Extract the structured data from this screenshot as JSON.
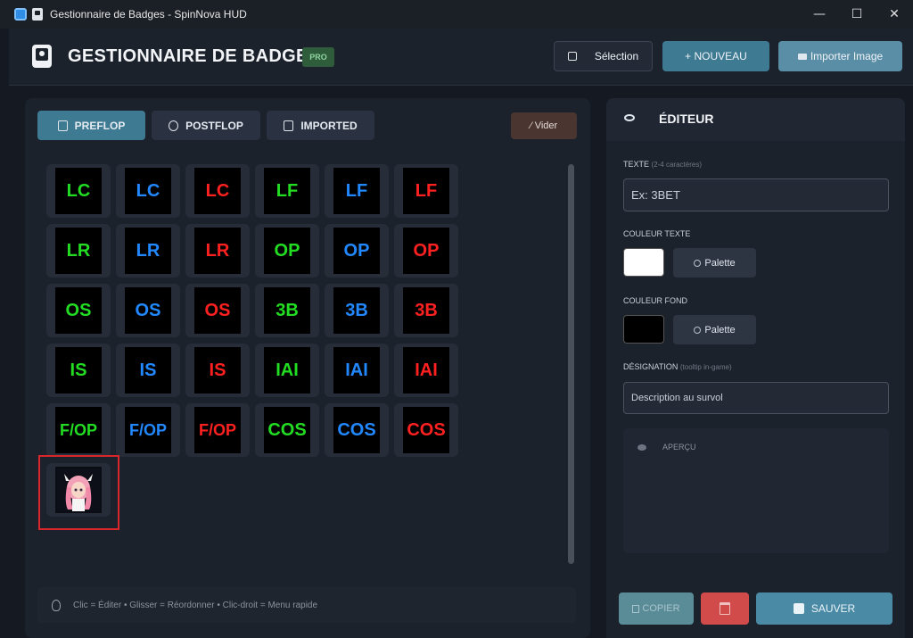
{
  "window": {
    "title": "Gestionnaire de Badges - SpinNova HUD",
    "controls": {
      "minimize": "—",
      "maximize": "☐",
      "close": "✕"
    }
  },
  "header": {
    "title": "GESTIONNAIRE DE BADGES",
    "pro_badge": "PRO",
    "selection_label": "Sélection",
    "new_label": "+ NOUVEAU",
    "import_label": "Importer Image"
  },
  "tabs": [
    {
      "label": "PREFLOP",
      "active": true
    },
    {
      "label": "POSTFLOP",
      "active": false
    },
    {
      "label": "IMPORTED",
      "active": false
    }
  ],
  "clear_label": "Vider",
  "badges": [
    {
      "text": "LC",
      "color": "green"
    },
    {
      "text": "LC",
      "color": "blue"
    },
    {
      "text": "LC",
      "color": "red"
    },
    {
      "text": "LF",
      "color": "green"
    },
    {
      "text": "LF",
      "color": "blue"
    },
    {
      "text": "LF",
      "color": "red"
    },
    {
      "text": "LR",
      "color": "green"
    },
    {
      "text": "LR",
      "color": "blue"
    },
    {
      "text": "LR",
      "color": "red"
    },
    {
      "text": "OP",
      "color": "green"
    },
    {
      "text": "OP",
      "color": "blue"
    },
    {
      "text": "OP",
      "color": "red"
    },
    {
      "text": "OS",
      "color": "green"
    },
    {
      "text": "OS",
      "color": "blue"
    },
    {
      "text": "OS",
      "color": "red"
    },
    {
      "text": "3B",
      "color": "green"
    },
    {
      "text": "3B",
      "color": "blue"
    },
    {
      "text": "3B",
      "color": "red"
    },
    {
      "text": "IS",
      "color": "green"
    },
    {
      "text": "IS",
      "color": "blue"
    },
    {
      "text": "IS",
      "color": "red"
    },
    {
      "text": "IAI",
      "color": "green"
    },
    {
      "text": "IAI",
      "color": "blue"
    },
    {
      "text": "IAI",
      "color": "red"
    },
    {
      "text": "F/OP",
      "color": "green"
    },
    {
      "text": "F/OP",
      "color": "blue"
    },
    {
      "text": "F/OP",
      "color": "red"
    },
    {
      "text": "COS",
      "color": "green"
    },
    {
      "text": "COS",
      "color": "blue"
    },
    {
      "text": "COS",
      "color": "red"
    }
  ],
  "image_badge": {
    "icon": "anime-character-image",
    "selected": true
  },
  "hint": "Clic = Éditer  •  Glisser = Réordonner  •  Clic-droit = Menu rapide",
  "editor": {
    "title": "ÉDITEUR",
    "text_label": "TEXTE",
    "text_sub": "(2-4 caractères)",
    "text_placeholder": "Ex: 3BET",
    "text_color_label": "COULEUR TEXTE",
    "text_color_value": "#ffffff",
    "bg_color_label": "COULEUR FOND",
    "bg_color_value": "#000000",
    "palette_label": "Palette",
    "designation_label": "DÉSIGNATION",
    "designation_sub": "(tooltip in-game)",
    "designation_placeholder": "Description au survol",
    "preview_label": "APERÇU",
    "copy_label": "COPIER",
    "save_label": "SAUVER"
  },
  "colors": {
    "green": "#22dd22",
    "blue": "#2288ff",
    "red": "#ff2020",
    "accent": "#3f7a93"
  }
}
